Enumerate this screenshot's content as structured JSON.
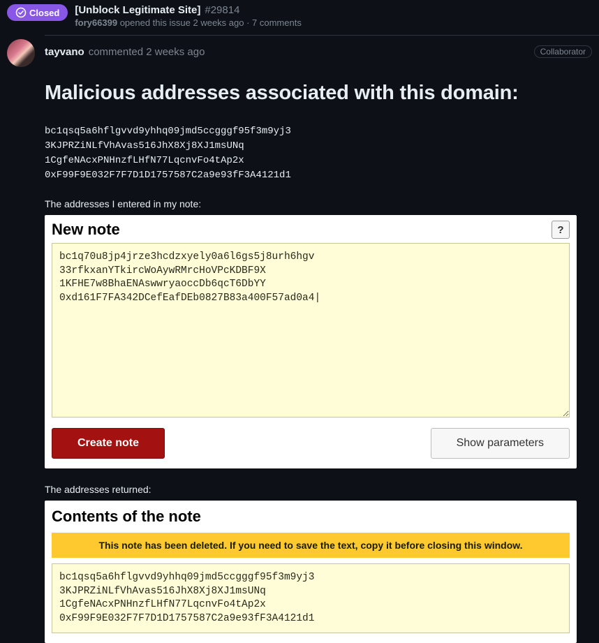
{
  "issue": {
    "status_label": "Closed",
    "title": "[Unblock Legitimate Site]",
    "number": "#29814",
    "opener": "fory66399",
    "opened_meta": "opened this issue 2 weeks ago · 7 comments"
  },
  "comment": {
    "author": "tayvano",
    "meta": "commented 2 weeks ago",
    "role": "Collaborator",
    "heading": "Malicious addresses associated with this domain:",
    "addresses": "bc1qsq5a6hflgvvd9yhhq09jmd5ccgggf95f3m9yj3\n3KJPRZiNLfVhAvas516JhX8Xj8XJ1msUNq\n1CgfeNAcxPNHnzfLHfN77LqcnvFo4tAp2x\n0xF99F9E032F7F7D1D1757587C2a9e93fF3A4121d1",
    "note_intro": "The addresses I entered in my note:",
    "returned_intro": "The addresses returned:"
  },
  "new_note_panel": {
    "title": "New note",
    "help": "?",
    "textarea_value": "bc1q70u8jp4jrze3hcdzxyely0a6l6gs5j8urh6hgv\n33rfkxanYTkircWoAywRMrcHoVPcKDBF9X\n1KFHE7w8BhaENAswwryaoccDb6qcT6DbYY\n0xd161F7FA342DCefEafDEb0827B83a400F57ad0a4|",
    "create_label": "Create note",
    "show_params_label": "Show parameters"
  },
  "contents_panel": {
    "title": "Contents of the note",
    "banner": "This note has been deleted. If you need to save the text, copy it before closing this window.",
    "body": "bc1qsq5a6hflgvvd9yhhq09jmd5ccgggf95f3m9yj3\n3KJPRZiNLfVhAvas516JhX8Xj8XJ1msUNq\n1CgfeNAcxPNHnzfLHfN77LqcnvFo4tAp2x\n0xF99F9E032F7F7D1D1757587C2a9e93fF3A4121d1"
  }
}
